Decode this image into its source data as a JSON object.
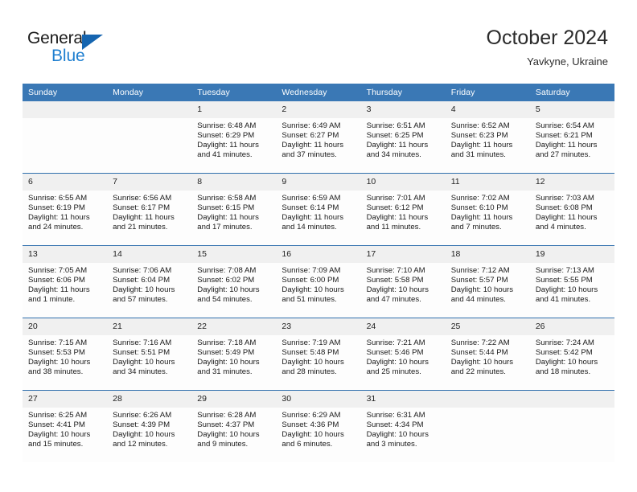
{
  "brand": {
    "name_top": "General",
    "name_bottom": "Blue",
    "accent_color": "#1f7fd0",
    "triangle_color": "#1565b0"
  },
  "header": {
    "title": "October 2024",
    "subtitle": "Yavkyne, Ukraine"
  },
  "calendar": {
    "header_bg": "#3a78b5",
    "row_border": "#2f6fad",
    "daynum_bg": "#f0f0f0",
    "weekdays": [
      "Sunday",
      "Monday",
      "Tuesday",
      "Wednesday",
      "Thursday",
      "Friday",
      "Saturday"
    ],
    "weeks": [
      [
        {
          "day": "",
          "empty": true
        },
        {
          "day": "",
          "empty": true
        },
        {
          "day": "1",
          "sunrise": "Sunrise: 6:48 AM",
          "sunset": "Sunset: 6:29 PM",
          "daylight_line1": "Daylight: 11 hours",
          "daylight_line2": "and 41 minutes."
        },
        {
          "day": "2",
          "sunrise": "Sunrise: 6:49 AM",
          "sunset": "Sunset: 6:27 PM",
          "daylight_line1": "Daylight: 11 hours",
          "daylight_line2": "and 37 minutes."
        },
        {
          "day": "3",
          "sunrise": "Sunrise: 6:51 AM",
          "sunset": "Sunset: 6:25 PM",
          "daylight_line1": "Daylight: 11 hours",
          "daylight_line2": "and 34 minutes."
        },
        {
          "day": "4",
          "sunrise": "Sunrise: 6:52 AM",
          "sunset": "Sunset: 6:23 PM",
          "daylight_line1": "Daylight: 11 hours",
          "daylight_line2": "and 31 minutes."
        },
        {
          "day": "5",
          "sunrise": "Sunrise: 6:54 AM",
          "sunset": "Sunset: 6:21 PM",
          "daylight_line1": "Daylight: 11 hours",
          "daylight_line2": "and 27 minutes."
        }
      ],
      [
        {
          "day": "6",
          "sunrise": "Sunrise: 6:55 AM",
          "sunset": "Sunset: 6:19 PM",
          "daylight_line1": "Daylight: 11 hours",
          "daylight_line2": "and 24 minutes."
        },
        {
          "day": "7",
          "sunrise": "Sunrise: 6:56 AM",
          "sunset": "Sunset: 6:17 PM",
          "daylight_line1": "Daylight: 11 hours",
          "daylight_line2": "and 21 minutes."
        },
        {
          "day": "8",
          "sunrise": "Sunrise: 6:58 AM",
          "sunset": "Sunset: 6:15 PM",
          "daylight_line1": "Daylight: 11 hours",
          "daylight_line2": "and 17 minutes."
        },
        {
          "day": "9",
          "sunrise": "Sunrise: 6:59 AM",
          "sunset": "Sunset: 6:14 PM",
          "daylight_line1": "Daylight: 11 hours",
          "daylight_line2": "and 14 minutes."
        },
        {
          "day": "10",
          "sunrise": "Sunrise: 7:01 AM",
          "sunset": "Sunset: 6:12 PM",
          "daylight_line1": "Daylight: 11 hours",
          "daylight_line2": "and 11 minutes."
        },
        {
          "day": "11",
          "sunrise": "Sunrise: 7:02 AM",
          "sunset": "Sunset: 6:10 PM",
          "daylight_line1": "Daylight: 11 hours",
          "daylight_line2": "and 7 minutes."
        },
        {
          "day": "12",
          "sunrise": "Sunrise: 7:03 AM",
          "sunset": "Sunset: 6:08 PM",
          "daylight_line1": "Daylight: 11 hours",
          "daylight_line2": "and 4 minutes."
        }
      ],
      [
        {
          "day": "13",
          "sunrise": "Sunrise: 7:05 AM",
          "sunset": "Sunset: 6:06 PM",
          "daylight_line1": "Daylight: 11 hours",
          "daylight_line2": "and 1 minute."
        },
        {
          "day": "14",
          "sunrise": "Sunrise: 7:06 AM",
          "sunset": "Sunset: 6:04 PM",
          "daylight_line1": "Daylight: 10 hours",
          "daylight_line2": "and 57 minutes."
        },
        {
          "day": "15",
          "sunrise": "Sunrise: 7:08 AM",
          "sunset": "Sunset: 6:02 PM",
          "daylight_line1": "Daylight: 10 hours",
          "daylight_line2": "and 54 minutes."
        },
        {
          "day": "16",
          "sunrise": "Sunrise: 7:09 AM",
          "sunset": "Sunset: 6:00 PM",
          "daylight_line1": "Daylight: 10 hours",
          "daylight_line2": "and 51 minutes."
        },
        {
          "day": "17",
          "sunrise": "Sunrise: 7:10 AM",
          "sunset": "Sunset: 5:58 PM",
          "daylight_line1": "Daylight: 10 hours",
          "daylight_line2": "and 47 minutes."
        },
        {
          "day": "18",
          "sunrise": "Sunrise: 7:12 AM",
          "sunset": "Sunset: 5:57 PM",
          "daylight_line1": "Daylight: 10 hours",
          "daylight_line2": "and 44 minutes."
        },
        {
          "day": "19",
          "sunrise": "Sunrise: 7:13 AM",
          "sunset": "Sunset: 5:55 PM",
          "daylight_line1": "Daylight: 10 hours",
          "daylight_line2": "and 41 minutes."
        }
      ],
      [
        {
          "day": "20",
          "sunrise": "Sunrise: 7:15 AM",
          "sunset": "Sunset: 5:53 PM",
          "daylight_line1": "Daylight: 10 hours",
          "daylight_line2": "and 38 minutes."
        },
        {
          "day": "21",
          "sunrise": "Sunrise: 7:16 AM",
          "sunset": "Sunset: 5:51 PM",
          "daylight_line1": "Daylight: 10 hours",
          "daylight_line2": "and 34 minutes."
        },
        {
          "day": "22",
          "sunrise": "Sunrise: 7:18 AM",
          "sunset": "Sunset: 5:49 PM",
          "daylight_line1": "Daylight: 10 hours",
          "daylight_line2": "and 31 minutes."
        },
        {
          "day": "23",
          "sunrise": "Sunrise: 7:19 AM",
          "sunset": "Sunset: 5:48 PM",
          "daylight_line1": "Daylight: 10 hours",
          "daylight_line2": "and 28 minutes."
        },
        {
          "day": "24",
          "sunrise": "Sunrise: 7:21 AM",
          "sunset": "Sunset: 5:46 PM",
          "daylight_line1": "Daylight: 10 hours",
          "daylight_line2": "and 25 minutes."
        },
        {
          "day": "25",
          "sunrise": "Sunrise: 7:22 AM",
          "sunset": "Sunset: 5:44 PM",
          "daylight_line1": "Daylight: 10 hours",
          "daylight_line2": "and 22 minutes."
        },
        {
          "day": "26",
          "sunrise": "Sunrise: 7:24 AM",
          "sunset": "Sunset: 5:42 PM",
          "daylight_line1": "Daylight: 10 hours",
          "daylight_line2": "and 18 minutes."
        }
      ],
      [
        {
          "day": "27",
          "sunrise": "Sunrise: 6:25 AM",
          "sunset": "Sunset: 4:41 PM",
          "daylight_line1": "Daylight: 10 hours",
          "daylight_line2": "and 15 minutes."
        },
        {
          "day": "28",
          "sunrise": "Sunrise: 6:26 AM",
          "sunset": "Sunset: 4:39 PM",
          "daylight_line1": "Daylight: 10 hours",
          "daylight_line2": "and 12 minutes."
        },
        {
          "day": "29",
          "sunrise": "Sunrise: 6:28 AM",
          "sunset": "Sunset: 4:37 PM",
          "daylight_line1": "Daylight: 10 hours",
          "daylight_line2": "and 9 minutes."
        },
        {
          "day": "30",
          "sunrise": "Sunrise: 6:29 AM",
          "sunset": "Sunset: 4:36 PM",
          "daylight_line1": "Daylight: 10 hours",
          "daylight_line2": "and 6 minutes."
        },
        {
          "day": "31",
          "sunrise": "Sunrise: 6:31 AM",
          "sunset": "Sunset: 4:34 PM",
          "daylight_line1": "Daylight: 10 hours",
          "daylight_line2": "and 3 minutes."
        },
        {
          "day": "",
          "empty": true
        },
        {
          "day": "",
          "empty": true
        }
      ]
    ]
  }
}
